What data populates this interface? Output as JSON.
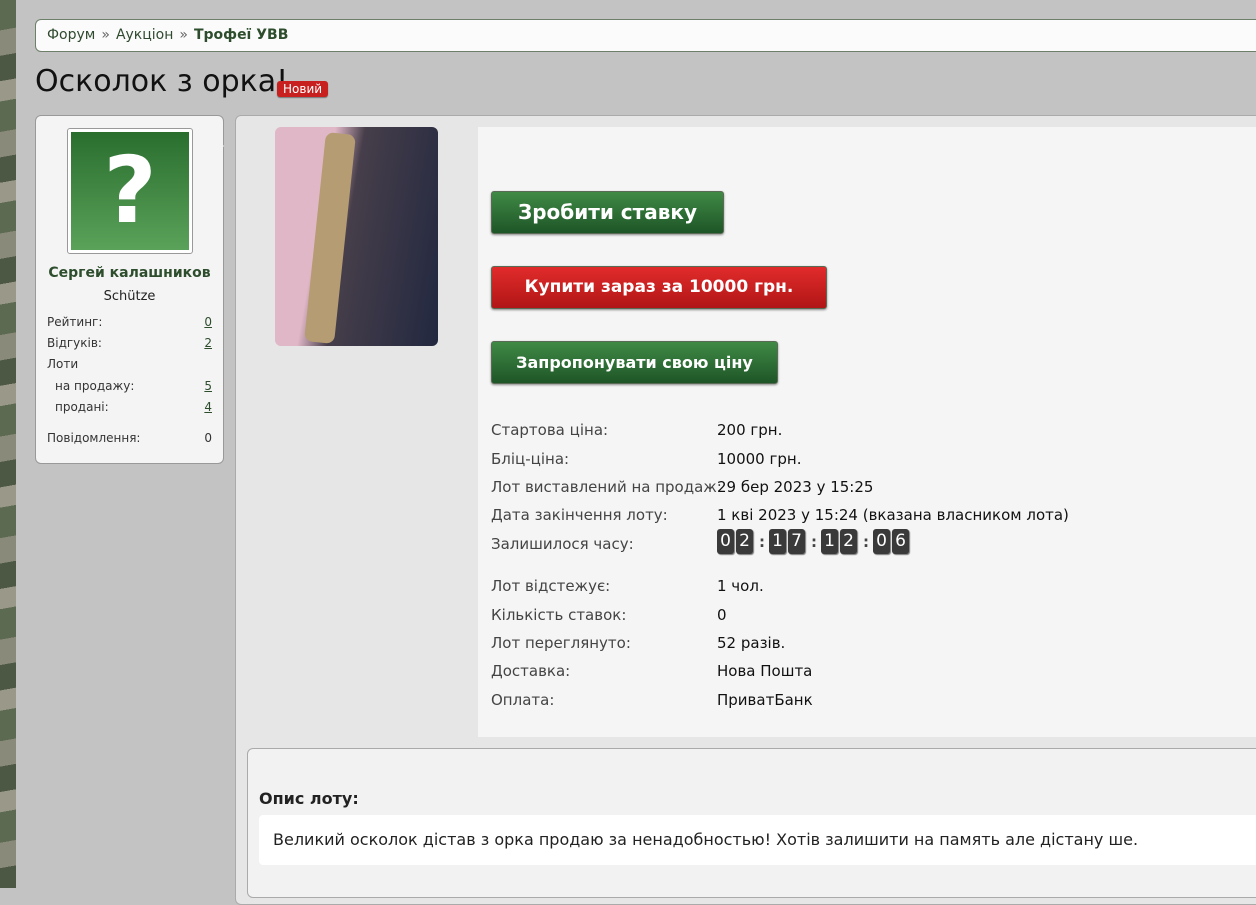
{
  "breadcrumb": {
    "items": [
      "Форум",
      "Аукціон"
    ],
    "current": "Трофеї УВВ",
    "sep": "»"
  },
  "title": "Осколок з орка!",
  "badge": "Новий",
  "user": {
    "name": "Сергей калашников",
    "rank": "Schütze",
    "avatar_glyph": "?",
    "stats": [
      {
        "label": "Рейтинг:",
        "value": "0"
      },
      {
        "label": "Відгуків:",
        "value": "2"
      },
      {
        "label": "Лоти",
        "value": ""
      },
      {
        "label": "на продажу:",
        "value": "5"
      },
      {
        "label": "продані:",
        "value": "4"
      },
      {
        "label": "Повідомлення:",
        "value": "0"
      }
    ]
  },
  "buttons": {
    "bid": "Зробити ставку",
    "buy_now": "Купити зараз за 10000 грн.",
    "offer": "Запропонувати свою ціну"
  },
  "details": [
    {
      "label": "Стартова ціна:",
      "value": "200 грн."
    },
    {
      "label": "Бліц-ціна:",
      "value": "10000 грн."
    },
    {
      "label": "Лот виставлений на продаж:",
      "value": "29 бер 2023 у 15:25"
    },
    {
      "label": "Дата закінчення лоту:",
      "value": "1 кві 2023 у 15:24 (вказана власником лота)"
    },
    {
      "label": "Залишилося часу:",
      "value": ""
    },
    {
      "label": "Лот відстежує:",
      "value": "1 чол."
    },
    {
      "label": "Кількість ставок:",
      "value": "0"
    },
    {
      "label": "Лот переглянуто:",
      "value": "52 разів."
    },
    {
      "label": "Доставка:",
      "value": "Нова Пошта"
    },
    {
      "label": "Оплата:",
      "value": "ПриватБанк"
    }
  ],
  "timer": {
    "digits": [
      "0",
      "2",
      "1",
      "7",
      "1",
      "2",
      "0",
      "6"
    ]
  },
  "description": {
    "title": "Опис лоту:",
    "text": "Великий осколок дістав з орка продаю за ненадобностью! Хотів залишити на память але дістану ше."
  }
}
